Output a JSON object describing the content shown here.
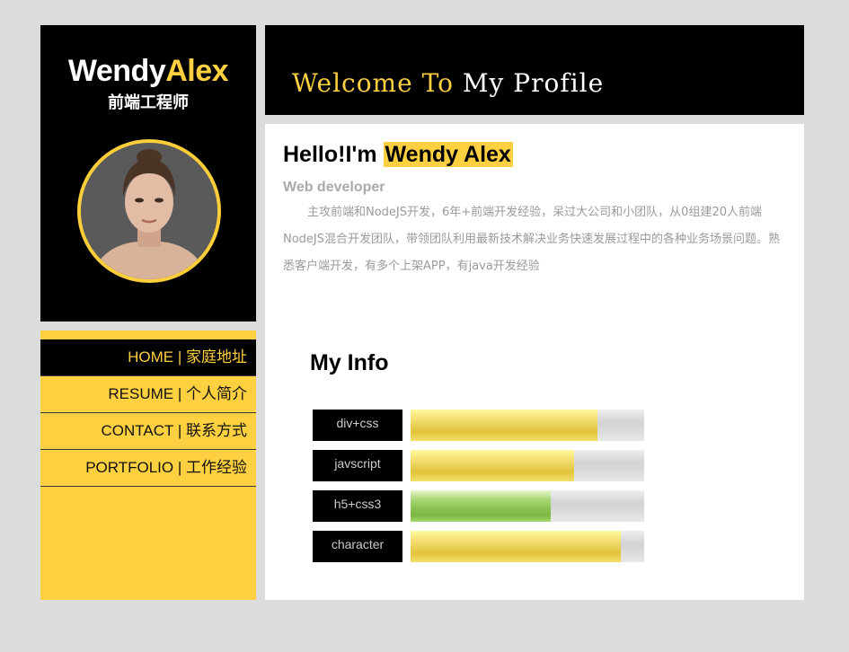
{
  "profile": {
    "first_name": "Wendy",
    "last_name": "Alex",
    "title": "前端工程师",
    "avatar_alt": "profile photo"
  },
  "nav": {
    "items": [
      {
        "label": "HOME | 家庭地址",
        "active": true
      },
      {
        "label": "RESUME | 个人简介",
        "active": false
      },
      {
        "label": "CONTACT | 联系方式",
        "active": false
      },
      {
        "label": "PORTFOLIO | 工作经验",
        "active": false
      }
    ]
  },
  "header": {
    "title_part1": "Welcome To",
    "title_part2": " My Profile"
  },
  "intro": {
    "greeting": "Hello!I'm ",
    "name": "Wendy Alex",
    "role": "Web developer",
    "bio": "主攻前端和NodeJS开发，6年+前端开发经验，呆过大公司和小团队，从0组建20人前端NodeJS混合开发团队，带领团队利用最新技术解决业务快速发展过程中的各种业务场景问题。熟悉客户端开发，有多个上架APP，有java开发经验"
  },
  "info": {
    "title": "My Info",
    "skills": [
      {
        "label": "div+css",
        "level": 0.8,
        "color": "yellow"
      },
      {
        "label": "javscript",
        "level": 0.7,
        "color": "yellow"
      },
      {
        "label": "h5+css3",
        "level": 0.6,
        "color": "green"
      },
      {
        "label": "character",
        "level": 0.9,
        "color": "yellow"
      }
    ]
  },
  "colors": {
    "accent": "#ffd03f",
    "dark": "#000000",
    "page_bg": "#dcdcdc"
  }
}
